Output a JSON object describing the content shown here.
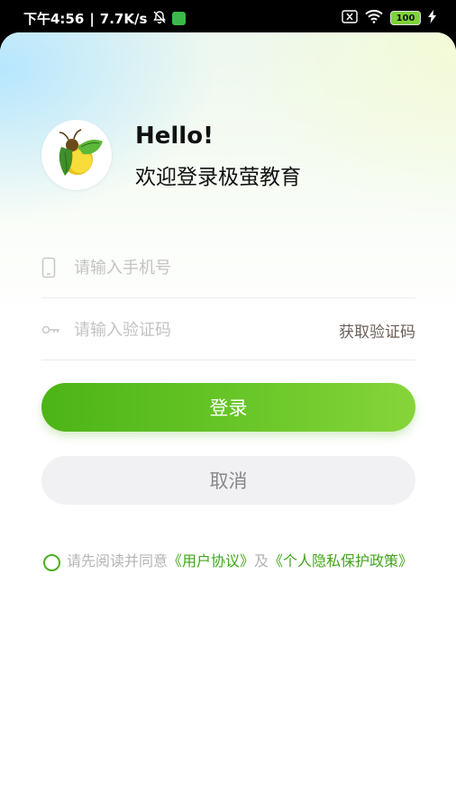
{
  "status_bar": {
    "time": "下午4:56",
    "separator": "|",
    "speed": "7.7K/s",
    "battery": "100"
  },
  "header": {
    "greeting": "Hello!",
    "welcome": "欢迎登录极萤教育"
  },
  "form": {
    "phone_placeholder": "请输入手机号",
    "code_placeholder": "请输入验证码",
    "get_code_label": "获取验证码"
  },
  "buttons": {
    "login_label": "登录",
    "cancel_label": "取消"
  },
  "agreement": {
    "prefix": "请先阅读并同意",
    "user_agreement": "《用户协议》",
    "and": "及",
    "privacy_policy": "《个人隐私保护政策》"
  },
  "colors": {
    "accent": "#4cb417",
    "link": "#3fa61a",
    "cancel_bg": "#f1f1f4"
  },
  "icons": {
    "phone": "phone-icon",
    "key": "key-icon",
    "logo": "firefly-logo"
  }
}
